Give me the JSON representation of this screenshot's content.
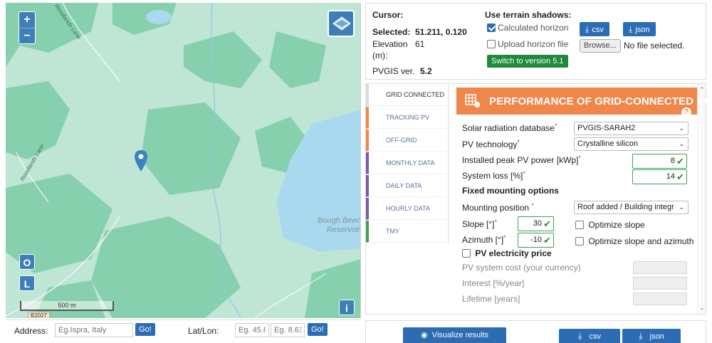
{
  "map": {
    "zoom_in": "+",
    "zoom_out": "−",
    "btn_o": "O",
    "btn_l": "L",
    "btn_info": "i",
    "scale_label": "500 m",
    "road_label_1": "Roodlands Lane",
    "road_label_2": "Roodlands Lane",
    "lake_label_1": "Bough Beec",
    "lake_label_2": "Reservoir",
    "road_badge": "B2027",
    "colors": {
      "land": "#bfe5d5",
      "forest": "#7fcea8",
      "water": "#a9d9ee",
      "marker": "#3b82c4"
    }
  },
  "address": {
    "address_label": "Address:",
    "address_placeholder": "Eg.Ispra, Italy",
    "go_label": "Go!",
    "latlon_label": "Lat/Lon:",
    "lat_placeholder": "Eg. 45.8",
    "lon_placeholder": "Eg. 8.61",
    "go2_label": "Go!"
  },
  "info": {
    "cursor_label": "Cursor:",
    "selected_label": "Selected:",
    "selected_value": "51.211, 0.120",
    "elevation_label": "Elevation",
    "elevation_unit": "(m):",
    "elevation_value": "61",
    "version_label": "PVGIS ver.",
    "version_value": "5.2",
    "terrain_title": "Use terrain shadows:",
    "calculated_horizon": "Calculated horizon",
    "upload_horizon": "Upload horizon file",
    "switch_version": "Switch to version 5.1",
    "csv": "csv",
    "json": "json",
    "browse": "Browse...",
    "no_file": "No file selected."
  },
  "tabs": [
    {
      "label": "GRID CONNECTED"
    },
    {
      "label": "TRACKING PV"
    },
    {
      "label": "OFF-GRID"
    },
    {
      "label": "MONTHLY DATA"
    },
    {
      "label": "DAILY DATA"
    },
    {
      "label": "HOURLY DATA"
    },
    {
      "label": "TMY"
    }
  ],
  "form": {
    "header": "PERFORMANCE OF GRID-CONNECTED PV",
    "help": "?",
    "radiation_db_label": "Solar radiation database",
    "radiation_db_value": "PVGIS-SARAH2",
    "pv_tech_label": "PV technology",
    "pv_tech_value": "Crystalline silicon",
    "peak_power_label": "Installed peak PV power [kWp]",
    "peak_power_value": "8",
    "system_loss_label": "System loss [%]",
    "system_loss_value": "14",
    "fixed_mounting_title": "Fixed mounting options",
    "mounting_position_label": "Mounting position",
    "mounting_position_value": "Roof added / Building integr",
    "slope_label": "Slope [°]",
    "slope_value": "30",
    "optimize_slope": "Optimize slope",
    "azimuth_label": "Azimuth [°]",
    "azimuth_value": "-10",
    "optimize_slope_azimuth": "Optimize slope and azimuth",
    "pv_price_label": "PV electricity price",
    "system_cost_label": "PV system cost (your currency)",
    "interest_label": "Interest [%/year]",
    "lifetime_label": "Lifetime [years]",
    "req_mark": "*",
    "ok_mark": "✔",
    "caret": "⌄",
    "scroll_up": "^",
    "scroll_down": "⌄"
  },
  "bottom": {
    "visualize": "Visualize results",
    "csv": "csv",
    "json": "json"
  }
}
